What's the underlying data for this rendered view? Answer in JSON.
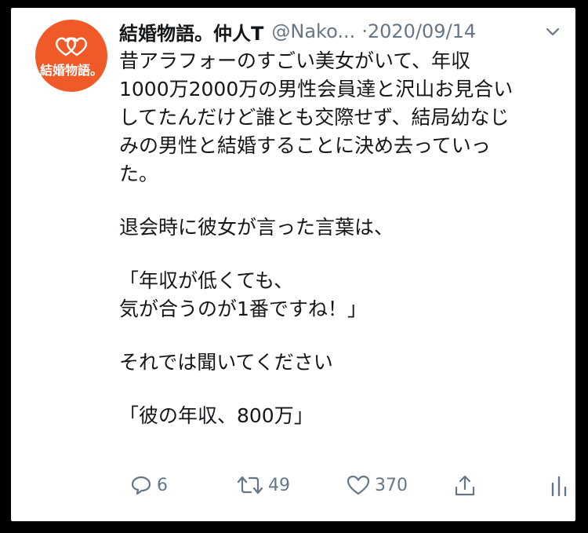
{
  "account": {
    "display_name": "結婚物語。仲人T",
    "handle": "@Nako...",
    "separator": "·",
    "date": "2020/09/14",
    "avatar_text": "結婚物語。"
  },
  "tweet": {
    "lines": [
      "昔アラフォーのすごい美女がいて、年収",
      "1000万2000万の男性会員達と沢山お見合い",
      "してたんだけど誰とも交際せず、結局幼なじ",
      "みの男性と結婚することに決め去っていっ",
      "た。",
      "",
      "退会時に彼女が言った言葉は、",
      "",
      "「年収が低くても、",
      "気が合うのが1番ですね！」",
      "",
      "それでは聞いてください",
      "",
      "「彼の年収、800万」"
    ]
  },
  "actions": {
    "reply_count": "6",
    "retweet_count": "49",
    "like_count": "370"
  },
  "icons": [
    "chevron-down-icon",
    "reply-icon",
    "retweet-icon",
    "like-icon",
    "share-icon",
    "analytics-icon",
    "heart-logo-icon"
  ],
  "colors": {
    "avatar_bg": "#f05a28",
    "muted": "#657786",
    "text": "#14171a"
  }
}
